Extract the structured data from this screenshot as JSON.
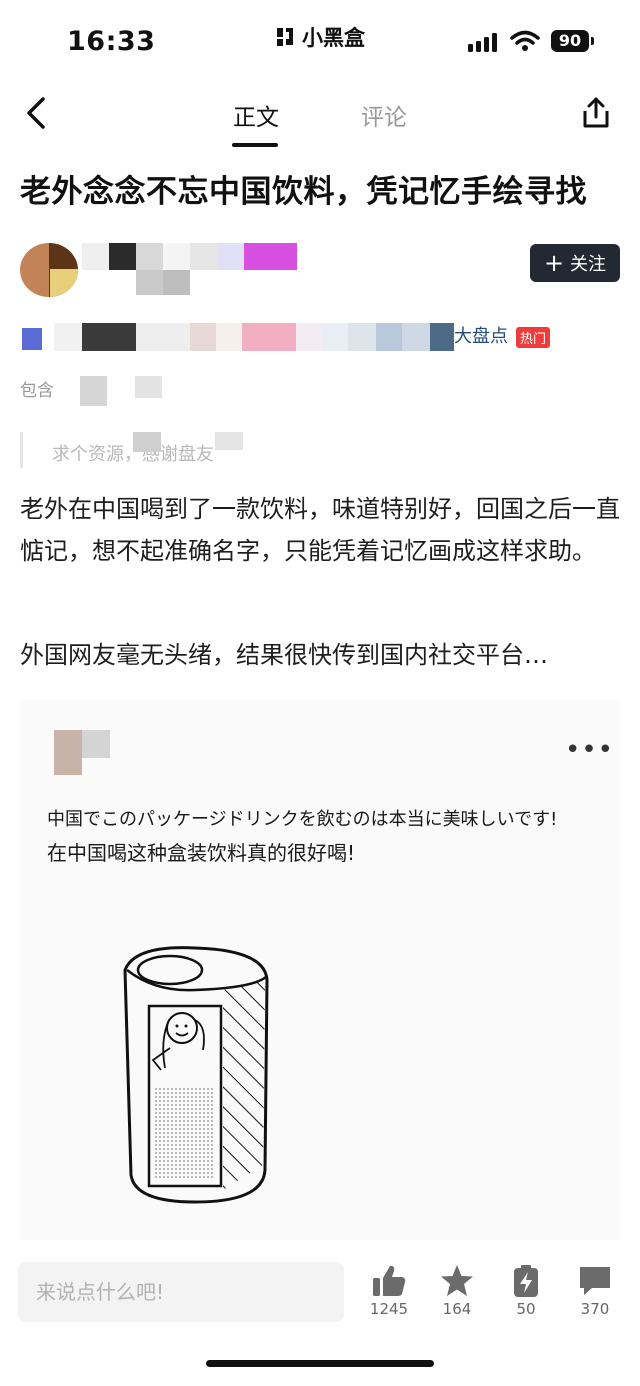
{
  "status_bar": {
    "time": "16:33",
    "app_name": "小黑盒",
    "battery": "90"
  },
  "nav": {
    "tabs": [
      {
        "label": "正文"
      },
      {
        "label": "评论"
      }
    ],
    "back_icon": "chevron-left-icon",
    "share_icon": "share-icon"
  },
  "article": {
    "title": "老外念念不忘中国饮料，凭记忆手绘寻找",
    "follow_label": "关注",
    "hot_word": "大盘点",
    "hot_badge": "热门",
    "contains_label": "包含",
    "quote_text": "求个资源，感谢盘友",
    "paragraphs": [
      "老外在中国喝到了一款饮料，味道特别好，回国之后一直惦记，想不起准确名字，只能凭着记忆画成这样求助。",
      "外国网友毫无头绪，结果很快传到国内社交平台…"
    ]
  },
  "embedded_post": {
    "more_icon": "ellipsis-icon",
    "caption_jp": "中国でこのパッケージドリンクを飲むのは本当に美味しいです!",
    "caption_cn": "在中国喝这种盒装饮料真的很好喝!"
  },
  "bottom_bar": {
    "comment_placeholder": "来说点什么吧!",
    "actions": [
      {
        "icon": "thumbs-up-icon",
        "count": "1245"
      },
      {
        "icon": "star-icon",
        "count": "164"
      },
      {
        "icon": "charge-icon",
        "count": "50"
      },
      {
        "icon": "comment-icon",
        "count": "370"
      }
    ]
  },
  "colors": {
    "follow_bg": "#232933",
    "hot_badge": "#ee3b3b",
    "icon_gray": "#6b6b6b"
  }
}
